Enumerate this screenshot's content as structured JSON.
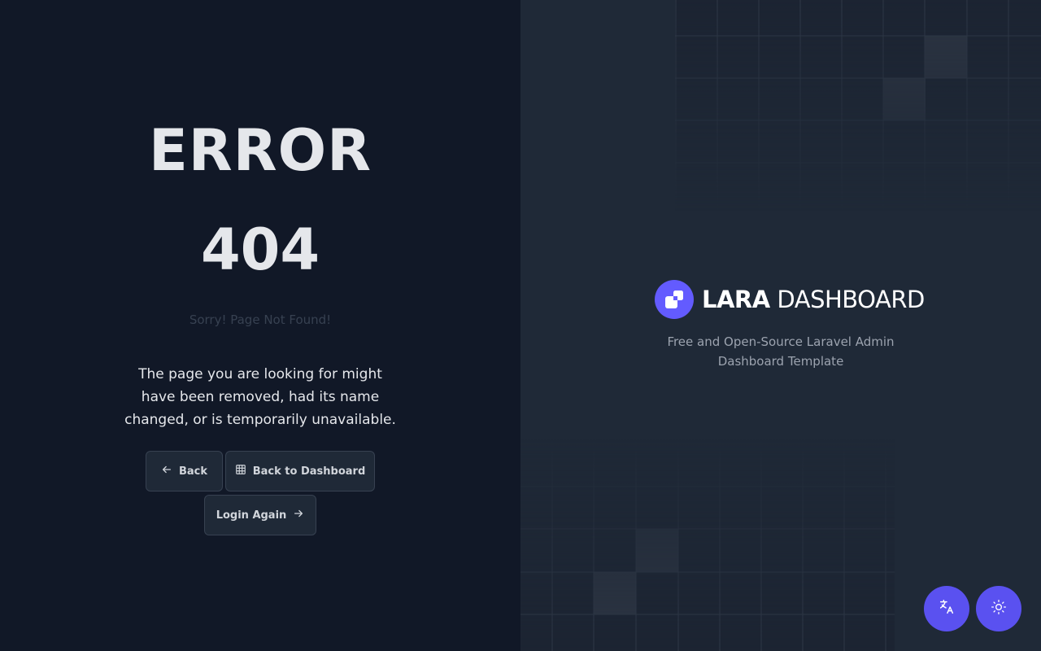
{
  "error": {
    "title": "ERROR",
    "code": "404",
    "subtitle": "Sorry! Page Not Found!",
    "description": "The page you are looking for might have been removed, had its name changed, or is temporarily unavailable."
  },
  "actions": {
    "back_label": "Back",
    "dashboard_label": "Back to Dashboard",
    "login_label": "Login Again"
  },
  "brand": {
    "name_bold": "LARA",
    "name_light": "DASHBOARD",
    "tagline": "Free and Open-Source Laravel Admin Dashboard Template",
    "accent_color": "#635bff"
  },
  "floating": {
    "translate_icon": "translate-icon",
    "theme_icon": "sun-icon"
  }
}
